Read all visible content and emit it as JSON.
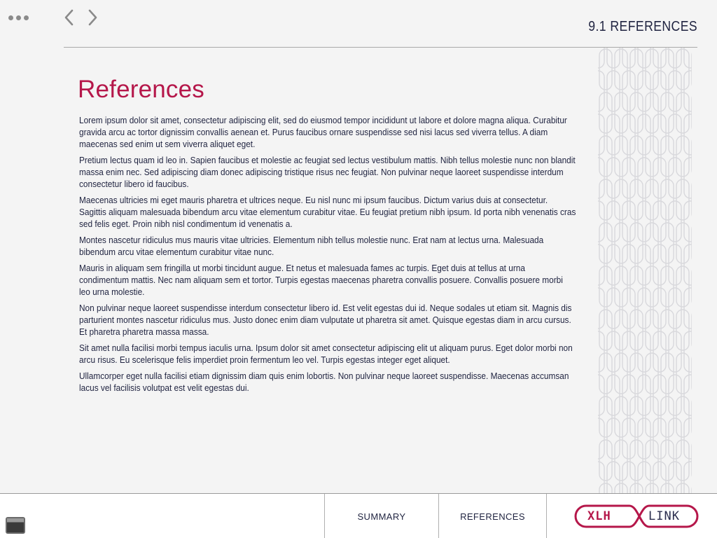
{
  "header": {
    "section_title": "9.1 REFERENCES"
  },
  "icons": {
    "menu": "more-dots-icon",
    "back": "chevron-left-icon",
    "forward": "chevron-right-icon",
    "thumbnails": "thumbnail-icon"
  },
  "main": {
    "heading": "References",
    "paragraphs": [
      "Lorem ipsum dolor sit amet, consectetur adipiscing elit, sed do eiusmod tempor incididunt ut labore et dolore magna aliqua. Curabitur gravida arcu ac tortor dignissim convallis aenean et. Purus faucibus ornare suspendisse sed nisi lacus sed viverra tellus. A diam maecenas sed enim ut sem viverra aliquet eget.",
      "Pretium lectus quam id leo in. Sapien faucibus et molestie ac feugiat sed lectus vestibulum mattis. Nibh tellus molestie nunc non blandit massa enim nec. Sed adipiscing diam donec adipiscing tristique risus nec feugiat. Non pulvinar neque laoreet suspendisse interdum consectetur libero id faucibus.",
      "Maecenas ultricies mi eget mauris pharetra et ultrices neque. Eu nisl nunc mi ipsum faucibus. Dictum varius duis at consectetur. Sagittis aliquam malesuada bibendum arcu vitae elementum curabitur vitae. Eu feugiat pretium nibh ipsum. Id porta nibh venenatis cras sed felis eget. Proin nibh nisl condimentum id venenatis a.",
      "Montes nascetur ridiculus mus mauris vitae ultricies. Elementum nibh tellus molestie nunc. Erat nam at lectus urna. Malesuada bibendum arcu vitae elementum curabitur vitae nunc.",
      "Mauris in aliquam sem fringilla ut morbi tincidunt augue. Et netus et malesuada fames ac turpis. Eget duis at tellus at urna condimentum mattis. Nec nam aliquam sem et tortor. Turpis egestas maecenas pharetra convallis posuere. Convallis posuere morbi leo urna molestie.",
      "Non pulvinar neque laoreet suspendisse interdum consectetur libero id. Est velit egestas dui id. Neque sodales ut etiam sit. Magnis dis parturient montes nascetur ridiculus mus. Justo donec enim diam vulputate ut pharetra sit amet. Quisque egestas diam in arcu cursus. Et pharetra pharetra massa massa.",
      "Sit amet nulla facilisi morbi tempus iaculis urna. Ipsum dolor sit amet consectetur adipiscing elit ut aliquam purus. Eget dolor morbi non arcu risus. Eu scelerisque felis imperdiet proin fermentum leo vel. Turpis egestas integer eget aliquet.",
      "Ullamcorper eget nulla facilisi etiam dignissim diam quis enim lobortis. Non pulvinar neque laoreet suspendisse. Maecenas accumsan lacus vel facilisis volutpat est velit egestas dui."
    ]
  },
  "footer": {
    "tabs": [
      "SUMMARY",
      "REFERENCES"
    ],
    "logo_left": "XLH",
    "logo_right": "LINK"
  },
  "colors": {
    "accent": "#b5174a",
    "text": "#1f2340",
    "background": "#f4f4f4"
  }
}
